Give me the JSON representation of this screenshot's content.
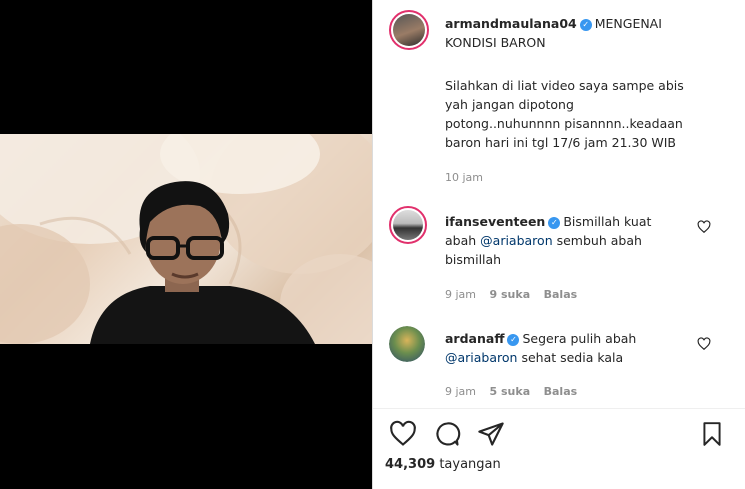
{
  "post": {
    "author": "armandmaulana04",
    "caption_line1": "MENGENAI",
    "caption_line2": "KONDISI BARON",
    "body_line1": "Silahkan di liat video saya sampe abis",
    "body_line2": "yah jangan dipotong",
    "body_line3": "potong..nuhunnnn pisannnn..keadaan",
    "body_line4": "baron hari ini tgl 17/6 jam 21.30 WIB",
    "time": "10 jam"
  },
  "comments": [
    {
      "username": "ifanseventeen",
      "text_a": "Bismillah kuat",
      "text_b1": "abah ",
      "mention": "@ariabaron",
      "text_b2": " sembuh abah",
      "text_c": "bismillah",
      "time": "9 jam",
      "likes": "9 suka",
      "reply": "Balas"
    },
    {
      "username": "ardanaff",
      "text_a": "Segera pulih abah",
      "mention": "@ariabaron",
      "text_b2": " sehat sedia kala",
      "time": "9 jam",
      "likes": "5 suka",
      "reply": "Balas"
    }
  ],
  "stats": {
    "views_count": "44,309",
    "views_label": "tayangan"
  },
  "colors": {
    "verified": "#3897f0",
    "mention": "#00376b",
    "meta": "#8e8e8e",
    "story_ring": "#e1306c"
  },
  "icons": [
    "heart-icon",
    "comment-icon",
    "share-icon",
    "bookmark-icon",
    "verified-badge-icon"
  ]
}
